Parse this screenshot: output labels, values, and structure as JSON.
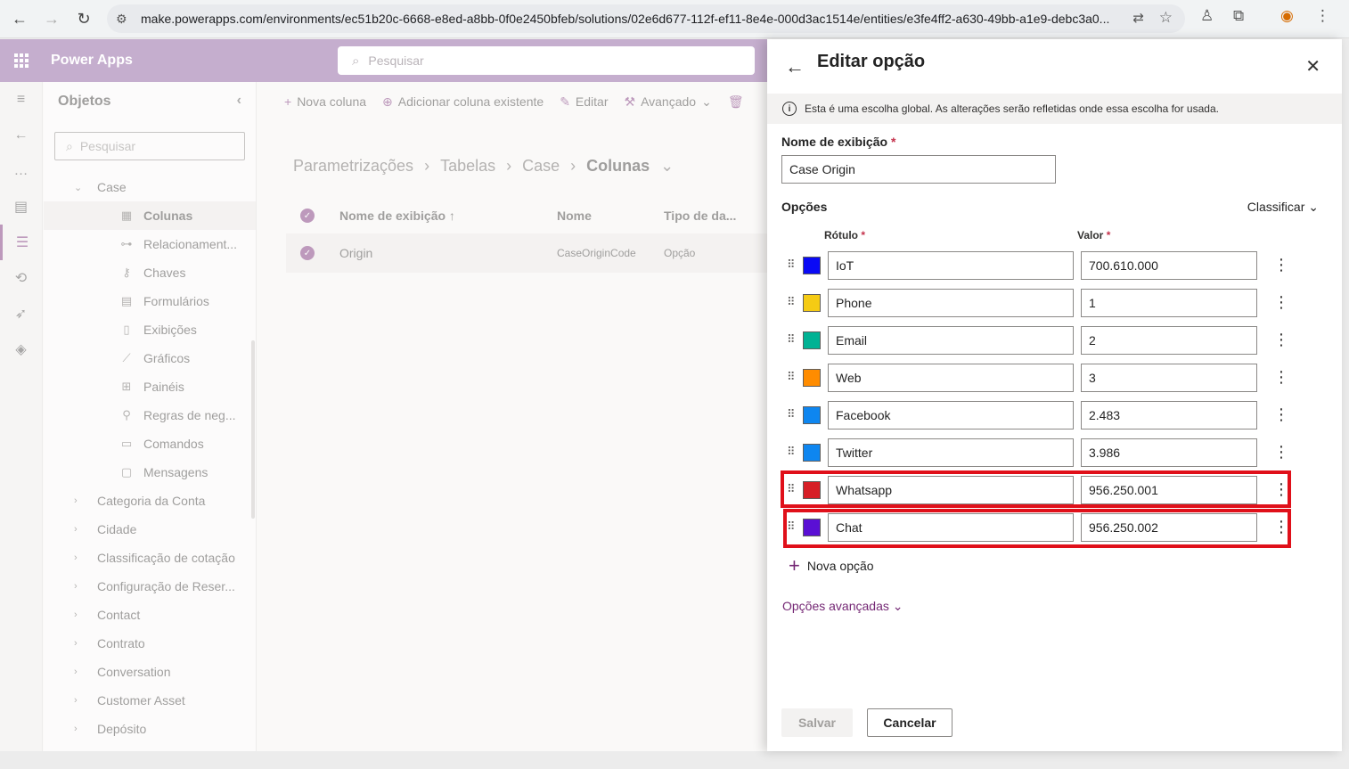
{
  "browser": {
    "url": "make.powerapps.com/environments/ec51b20c-6668-e8ed-a8bb-0f0e2450bfeb/solutions/02e6d677-112f-ef11-8e4e-000d3ac1514e/entities/e3fe4ff2-a630-49bb-a1e9-debc3a0..."
  },
  "app": {
    "title": "Power Apps",
    "search_placeholder": "Pesquisar"
  },
  "objects": {
    "title": "Objetos",
    "search_placeholder": "Pesquisar",
    "case_label": "Case",
    "children": [
      {
        "label": "Colunas",
        "icon": "column-icon"
      },
      {
        "label": "Relacionament...",
        "icon": "relationship-icon"
      },
      {
        "label": "Chaves",
        "icon": "key-icon"
      },
      {
        "label": "Formulários",
        "icon": "form-icon"
      },
      {
        "label": "Exibições",
        "icon": "view-icon"
      },
      {
        "label": "Gráficos",
        "icon": "chart-icon"
      },
      {
        "label": "Painéis",
        "icon": "dashboard-icon"
      },
      {
        "label": "Regras de neg...",
        "icon": "business-rule-icon"
      },
      {
        "label": "Comandos",
        "icon": "command-icon"
      },
      {
        "label": "Mensagens",
        "icon": "message-icon"
      }
    ],
    "tables": [
      "Categoria da Conta",
      "Cidade",
      "Classificação de cotação",
      "Configuração de Reser...",
      "Contact",
      "Contrato",
      "Conversation",
      "Customer Asset",
      "Depósito"
    ]
  },
  "commandbar": {
    "new_column": "Nova coluna",
    "add_existing": "Adicionar coluna existente",
    "edit": "Editar",
    "advanced": "Avançado"
  },
  "breadcrumb": [
    "Parametrizações",
    "Tabelas",
    "Case",
    "Colunas"
  ],
  "grid": {
    "headers": [
      "Nome de exibição ↑",
      "Nome",
      "Tipo de da..."
    ],
    "row": {
      "display_name": "Origin",
      "name": "CaseOriginCode",
      "type": "Opção"
    }
  },
  "panel": {
    "title": "Editar opção",
    "info": "Esta é uma escolha global. As alterações serão refletidas onde essa escolha for usada.",
    "display_name_label": "Nome de exibição",
    "display_name_value": "Case Origin",
    "options_label": "Opções",
    "sort_label": "Classificar",
    "col_label": "Rótulo",
    "col_value": "Valor",
    "options": [
      {
        "label": "IoT",
        "value": "700.610.000",
        "color": "#0a0af5"
      },
      {
        "label": "Phone",
        "value": "1",
        "color": "#f5cb14"
      },
      {
        "label": "Email",
        "value": "2",
        "color": "#00b294"
      },
      {
        "label": "Web",
        "value": "3",
        "color": "#ff8c00"
      },
      {
        "label": "Facebook",
        "value": "2.483",
        "color": "#0e86f0"
      },
      {
        "label": "Twitter",
        "value": "3.986",
        "color": "#0e86f0"
      },
      {
        "label": "Whatsapp",
        "value": "956.250.001",
        "color": "#d61f26"
      },
      {
        "label": "Chat",
        "value": "956.250.002",
        "color": "#5a0fd4"
      }
    ],
    "new_option": "Nova opção",
    "advanced_options": "Opções avançadas",
    "save": "Salvar",
    "cancel": "Cancelar"
  }
}
